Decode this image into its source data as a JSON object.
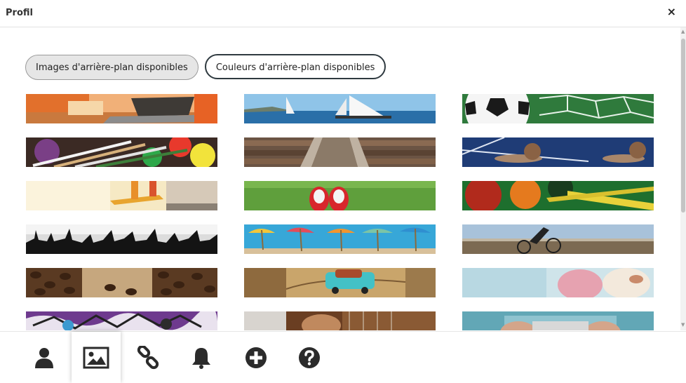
{
  "header": {
    "title": "Profil",
    "close_label": "×"
  },
  "tabs": [
    {
      "label": "Images d'arrière-plan disponibles",
      "active": true
    },
    {
      "label": "Couleurs d'arrière-plan disponibles",
      "active": false
    }
  ],
  "backgrounds": [
    {
      "icon": "desk-laptop-image"
    },
    {
      "icon": "sailboats-image"
    },
    {
      "icon": "soccer-ball-image"
    },
    {
      "icon": "paintbrushes-image"
    },
    {
      "icon": "railway-tracks-image"
    },
    {
      "icon": "snails-image"
    },
    {
      "icon": "skateboard-image"
    },
    {
      "icon": "sneakers-grass-image"
    },
    {
      "icon": "billiard-balls-image"
    },
    {
      "icon": "concert-crowd-image"
    },
    {
      "icon": "beach-umbrellas-image"
    },
    {
      "icon": "cyclist-image"
    },
    {
      "icon": "coffee-beans-image"
    },
    {
      "icon": "map-toy-car-image"
    },
    {
      "icon": "ice-cream-image"
    },
    {
      "icon": "graffiti-image"
    },
    {
      "icon": "guitar-image"
    },
    {
      "icon": "camera-hands-image"
    }
  ],
  "footer": {
    "icons": [
      {
        "name": "user-icon",
        "active": false
      },
      {
        "name": "image-icon",
        "active": true
      },
      {
        "name": "link-icon",
        "active": false
      },
      {
        "name": "bell-icon",
        "active": false
      },
      {
        "name": "plus-circle-icon",
        "active": false
      },
      {
        "name": "help-circle-icon",
        "active": false
      }
    ]
  },
  "colors": {
    "icon": "#2b2b2b",
    "tab_active_bg": "#e6e6e6",
    "tab_inactive_border": "#2f3a40"
  }
}
